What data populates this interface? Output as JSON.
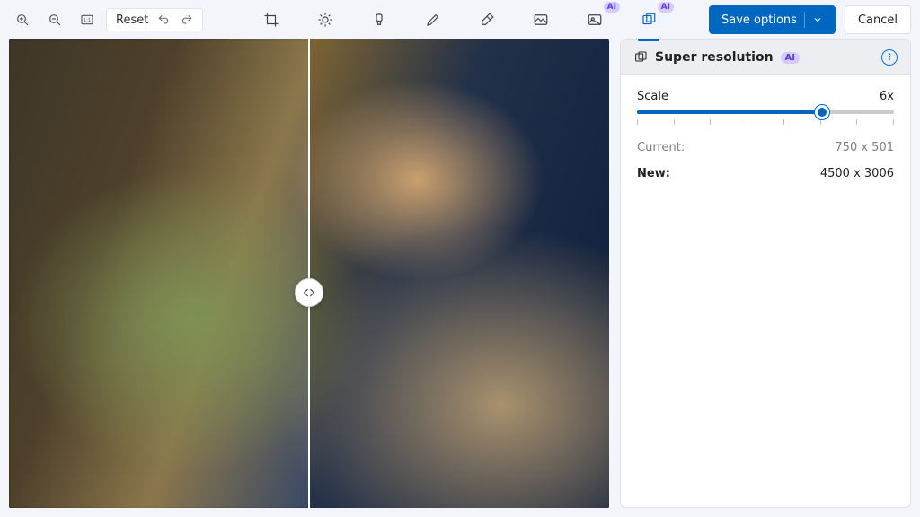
{
  "toolbar": {
    "reset_label": "Reset",
    "save_label": "Save options",
    "cancel_label": "Cancel",
    "ai_badge": "AI"
  },
  "panel": {
    "title": "Super resolution",
    "ai_badge": "AI",
    "scale_label": "Scale",
    "scale_value": "6x",
    "current_label": "Current:",
    "current_value": "750 x 501",
    "new_label": "New:",
    "new_value": "4500 x 3006"
  },
  "slider": {
    "percent": 72,
    "ticks": 8
  }
}
